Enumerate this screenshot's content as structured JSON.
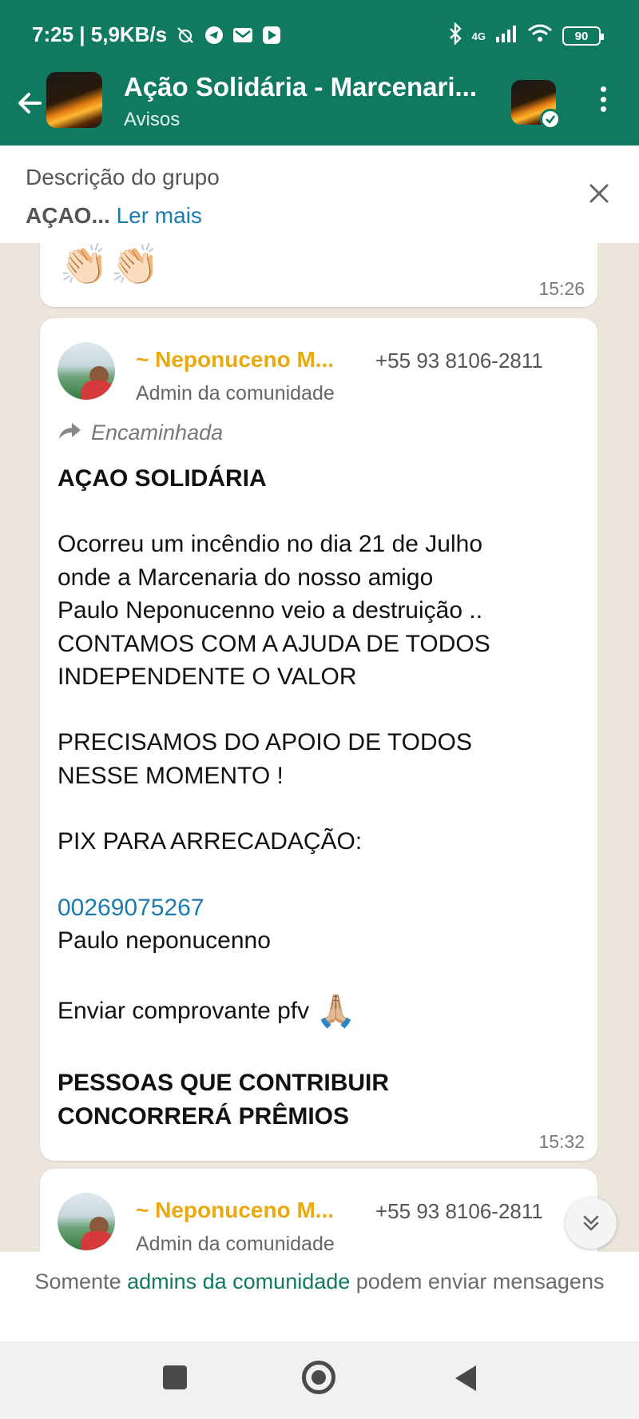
{
  "status_bar": {
    "time_speed": "7:25 | 5,9KB/s",
    "network": "4G",
    "battery": "90"
  },
  "header": {
    "title": "Ação Solidária - Marcenari...",
    "subtitle": "Avisos"
  },
  "description": {
    "title": "Descrição do grupo",
    "text": "AÇAO...",
    "more_link": "Ler mais"
  },
  "messages": [
    {
      "content": "👏🏻👏🏻",
      "time": "15:26"
    },
    {
      "sender_name": "~ Neponuceno M...",
      "sender_phone": "+55 93 8106-2811",
      "sender_role": "Admin da comunidade",
      "forwarded_label": "Encaminhada",
      "lines": {
        "title": "AÇAO SOLIDÁRIA",
        "l1": "Ocorreu um incêndio no dia 21 de Julho",
        "l2": "onde a Marcenaria do nosso amigo",
        "l3": "Paulo Neponucenno veio a destruição ..",
        "l4": "CONTAMOS COM A AJUDA DE TODOS",
        "l5": "INDEPENDENTE O VALOR",
        "l6": "PRECISAMOS DO APOIO DE TODOS",
        "l7": "NESSE MOMENTO !",
        "l8": "PIX PARA ARRECADAÇÃO:",
        "pix": "00269075267",
        "l9": " Paulo neponucenno",
        "l10": "Enviar comprovante pfv",
        "l10_emoji": "🙏🏼",
        "l11": "PESSOAS QUE CONTRIBUIR",
        "l12": "CONCORRERÁ PRÊMIOS"
      },
      "time": "15:32"
    },
    {
      "sender_name": "~ Neponuceno M...",
      "sender_phone": "+55 93 8106-2811",
      "sender_role": "Admin da comunidade"
    }
  ],
  "footer": {
    "prefix": "Somente ",
    "link": "admins da comunidade",
    "suffix": " podem enviar mensagens"
  },
  "colors": {
    "header_green": "#0f7a5f",
    "sender_name": "#e9a90f",
    "link_blue": "#1b7bb0",
    "chat_background": "#ece5dd"
  },
  "icons": {
    "back": "arrow-left-icon",
    "menu": "more-vertical-icon",
    "close": "close-icon",
    "forward": "forward-arrow-icon",
    "scroll": "chevron-double-down-icon"
  }
}
